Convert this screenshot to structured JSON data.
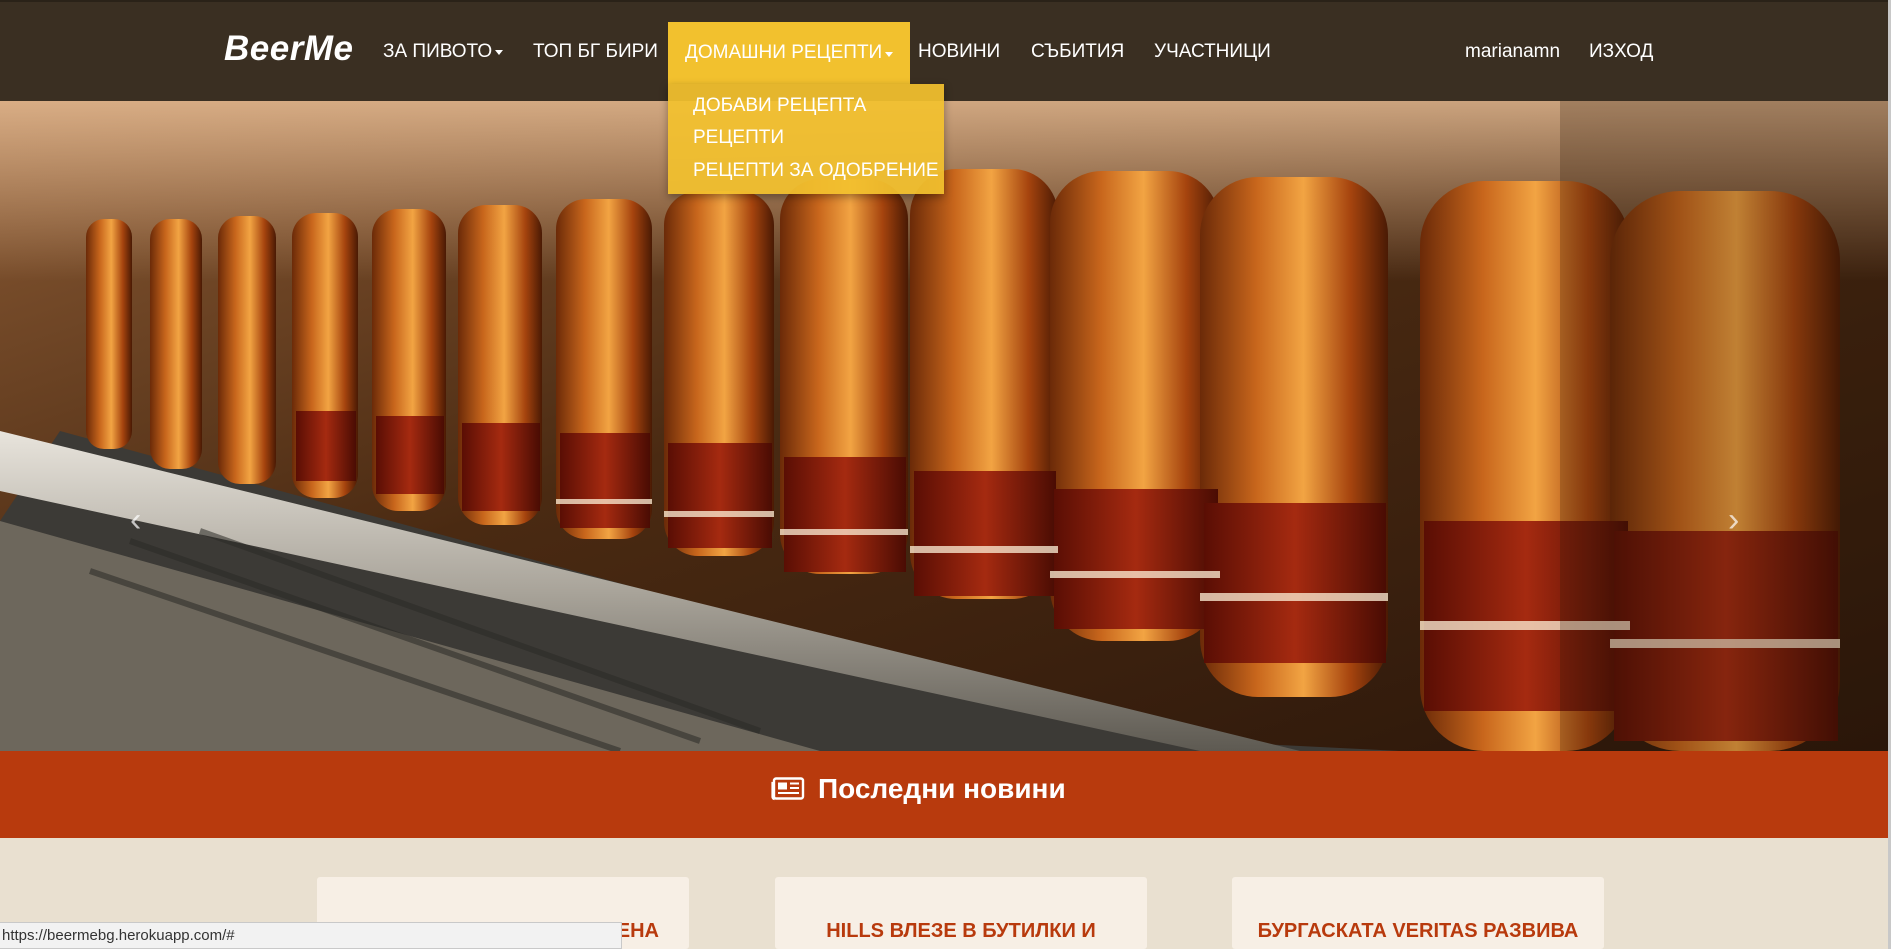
{
  "brand": "BeerMe",
  "nav": {
    "about_beer": "ЗА ПИВОТО",
    "top_bg": "ТОП БГ БИРИ",
    "home_recipes": "ДОМАШНИ РЕЦЕПТИ",
    "news": "НОВИНИ",
    "events": "СЪБИТИЯ",
    "members": "УЧАСТНИЦИ",
    "user": "marianamn",
    "logout": "ИЗХОД"
  },
  "dropdown": {
    "items": [
      "ДОБАВИ РЕЦЕПТА",
      "РЕЦЕПТИ",
      "РЕЦЕПТИ ЗА ОДОБРЕНИЕ"
    ]
  },
  "carousel": {
    "prev": "‹",
    "next": "›",
    "slide_count": 3,
    "active_slide": 1
  },
  "news_section": {
    "title": "Последни новини"
  },
  "cards": [
    {
      "title": "ЕНА"
    },
    {
      "title": "HILLS ВЛЕЗЕ В БУТИЛКИ И"
    },
    {
      "title": "БУРГАСКАТА VERITAS РАЗВИВА"
    }
  ],
  "status_bar": {
    "url": "https://beermebg.herokuapp.com/#"
  },
  "colors": {
    "navbar": "#3a2f22",
    "accent_yellow": "#f2c12e",
    "news_band": "#b83a0d",
    "page_bg": "#e9e0d0"
  }
}
